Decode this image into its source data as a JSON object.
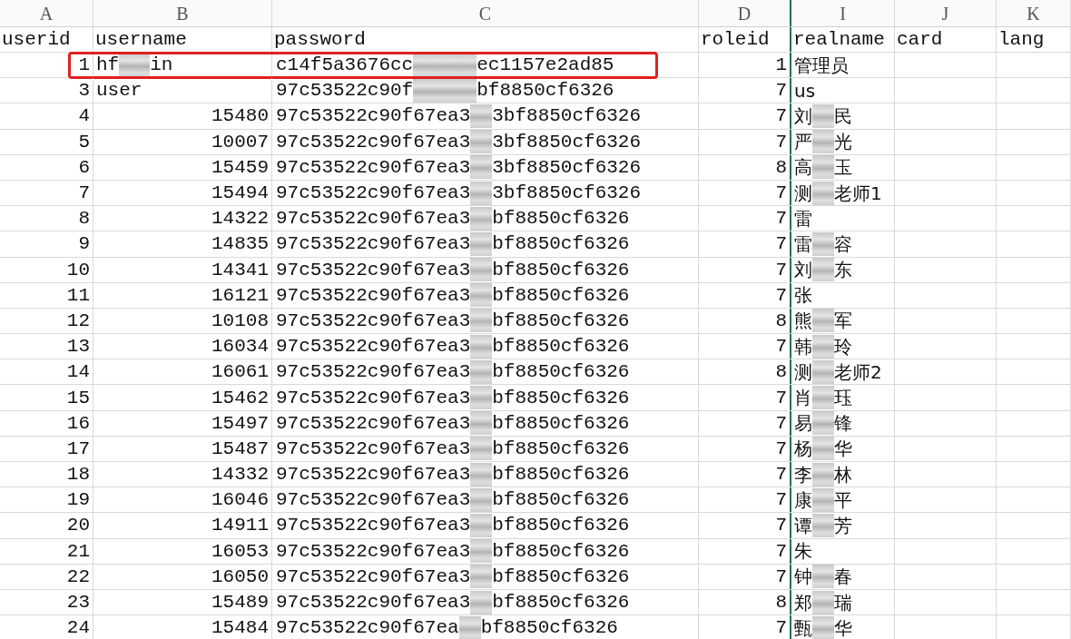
{
  "columns": [
    {
      "letter": "A",
      "header": "userid"
    },
    {
      "letter": "B",
      "header": "username"
    },
    {
      "letter": "C",
      "header": "password"
    },
    {
      "letter": "D",
      "header": "roleid"
    },
    {
      "letter": "I",
      "header": "realname"
    },
    {
      "letter": "J",
      "header": "card"
    },
    {
      "letter": "K",
      "header": "lang"
    }
  ],
  "rows": [
    {
      "userid": "1",
      "username": [
        "hf",
        "in"
      ],
      "kind": "text",
      "password": [
        "c14f5a3676cc",
        "ec1157e2ad85"
      ],
      "roleid": "1",
      "realname": [
        "管理员"
      ],
      "highlighted": true
    },
    {
      "userid": "3",
      "username": [
        "user"
      ],
      "kind": "text",
      "password": [
        "97c53522c90f",
        "bf8850cf6326"
      ],
      "roleid": "7",
      "realname": [
        "us"
      ],
      "highlighted": false
    },
    {
      "userid": "4",
      "username": [
        "15480"
      ],
      "kind": "number",
      "password": [
        "97c53522c90f67ea3",
        "3bf8850cf6326"
      ],
      "roleid": "7",
      "realname": [
        "刘",
        "民"
      ],
      "highlighted": false
    },
    {
      "userid": "5",
      "username": [
        "10007"
      ],
      "kind": "number",
      "password": [
        "97c53522c90f67ea3",
        "3bf8850cf6326"
      ],
      "roleid": "7",
      "realname": [
        "严",
        "光"
      ],
      "highlighted": false
    },
    {
      "userid": "6",
      "username": [
        "15459"
      ],
      "kind": "number",
      "password": [
        "97c53522c90f67ea3",
        "3bf8850cf6326"
      ],
      "roleid": "8",
      "realname": [
        "高",
        "玉"
      ],
      "highlighted": false
    },
    {
      "userid": "7",
      "username": [
        "15494"
      ],
      "kind": "number",
      "password": [
        "97c53522c90f67ea3",
        "3bf8850cf6326"
      ],
      "roleid": "7",
      "realname": [
        "测",
        "老师1"
      ],
      "highlighted": false
    },
    {
      "userid": "8",
      "username": [
        "14322"
      ],
      "kind": "number",
      "password": [
        "97c53522c90f67ea3",
        "bf8850cf6326"
      ],
      "roleid": "7",
      "realname": [
        "雷"
      ],
      "highlighted": false
    },
    {
      "userid": "9",
      "username": [
        "14835"
      ],
      "kind": "number",
      "password": [
        "97c53522c90f67ea3",
        "bf8850cf6326"
      ],
      "roleid": "7",
      "realname": [
        "雷",
        "容"
      ],
      "highlighted": false
    },
    {
      "userid": "10",
      "username": [
        "14341"
      ],
      "kind": "number",
      "password": [
        "97c53522c90f67ea3",
        "bf8850cf6326"
      ],
      "roleid": "7",
      "realname": [
        "刘",
        "东"
      ],
      "highlighted": false
    },
    {
      "userid": "11",
      "username": [
        "16121"
      ],
      "kind": "number",
      "password": [
        "97c53522c90f67ea3",
        "bf8850cf6326"
      ],
      "roleid": "7",
      "realname": [
        "张"
      ],
      "highlighted": false
    },
    {
      "userid": "12",
      "username": [
        "10108"
      ],
      "kind": "number",
      "password": [
        "97c53522c90f67ea3",
        "bf8850cf6326"
      ],
      "roleid": "8",
      "realname": [
        "熊",
        "军"
      ],
      "highlighted": false
    },
    {
      "userid": "13",
      "username": [
        "16034"
      ],
      "kind": "number",
      "password": [
        "97c53522c90f67ea3",
        "bf8850cf6326"
      ],
      "roleid": "7",
      "realname": [
        "韩",
        "玲"
      ],
      "highlighted": false
    },
    {
      "userid": "14",
      "username": [
        "16061"
      ],
      "kind": "number",
      "password": [
        "97c53522c90f67ea3",
        "bf8850cf6326"
      ],
      "roleid": "8",
      "realname": [
        "测",
        "老师2"
      ],
      "highlighted": false
    },
    {
      "userid": "15",
      "username": [
        "15462"
      ],
      "kind": "number",
      "password": [
        "97c53522c90f67ea3",
        "bf8850cf6326"
      ],
      "roleid": "7",
      "realname": [
        "肖",
        "珏"
      ],
      "highlighted": false
    },
    {
      "userid": "16",
      "username": [
        "15497"
      ],
      "kind": "number",
      "password": [
        "97c53522c90f67ea3",
        "bf8850cf6326"
      ],
      "roleid": "7",
      "realname": [
        "易",
        "锋"
      ],
      "highlighted": false
    },
    {
      "userid": "17",
      "username": [
        "15487"
      ],
      "kind": "number",
      "password": [
        "97c53522c90f67ea3",
        "bf8850cf6326"
      ],
      "roleid": "7",
      "realname": [
        "杨",
        "华"
      ],
      "highlighted": false
    },
    {
      "userid": "18",
      "username": [
        "14332"
      ],
      "kind": "number",
      "password": [
        "97c53522c90f67ea3",
        "bf8850cf6326"
      ],
      "roleid": "7",
      "realname": [
        "李",
        "林"
      ],
      "highlighted": false
    },
    {
      "userid": "19",
      "username": [
        "16046"
      ],
      "kind": "number",
      "password": [
        "97c53522c90f67ea3",
        "bf8850cf6326"
      ],
      "roleid": "7",
      "realname": [
        "康",
        "平"
      ],
      "highlighted": false
    },
    {
      "userid": "20",
      "username": [
        "14911"
      ],
      "kind": "number",
      "password": [
        "97c53522c90f67ea3",
        "bf8850cf6326"
      ],
      "roleid": "7",
      "realname": [
        "谭",
        "芳"
      ],
      "highlighted": false
    },
    {
      "userid": "21",
      "username": [
        "16053"
      ],
      "kind": "number",
      "password": [
        "97c53522c90f67ea3",
        "bf8850cf6326"
      ],
      "roleid": "7",
      "realname": [
        "朱"
      ],
      "highlighted": false
    },
    {
      "userid": "22",
      "username": [
        "16050"
      ],
      "kind": "number",
      "password": [
        "97c53522c90f67ea3",
        "bf8850cf6326"
      ],
      "roleid": "7",
      "realname": [
        "钟",
        "春"
      ],
      "highlighted": false
    },
    {
      "userid": "23",
      "username": [
        "15489"
      ],
      "kind": "number",
      "password": [
        "97c53522c90f67ea3",
        "bf8850cf6326"
      ],
      "roleid": "8",
      "realname": [
        "郑",
        "瑞"
      ],
      "highlighted": false
    },
    {
      "userid": "24",
      "username": [
        "15484"
      ],
      "kind": "number",
      "password": [
        "97c53522c90f67ea",
        "bf8850cf6326"
      ],
      "roleid": "7",
      "realname": [
        "甄",
        "华"
      ],
      "highlighted": false
    }
  ]
}
